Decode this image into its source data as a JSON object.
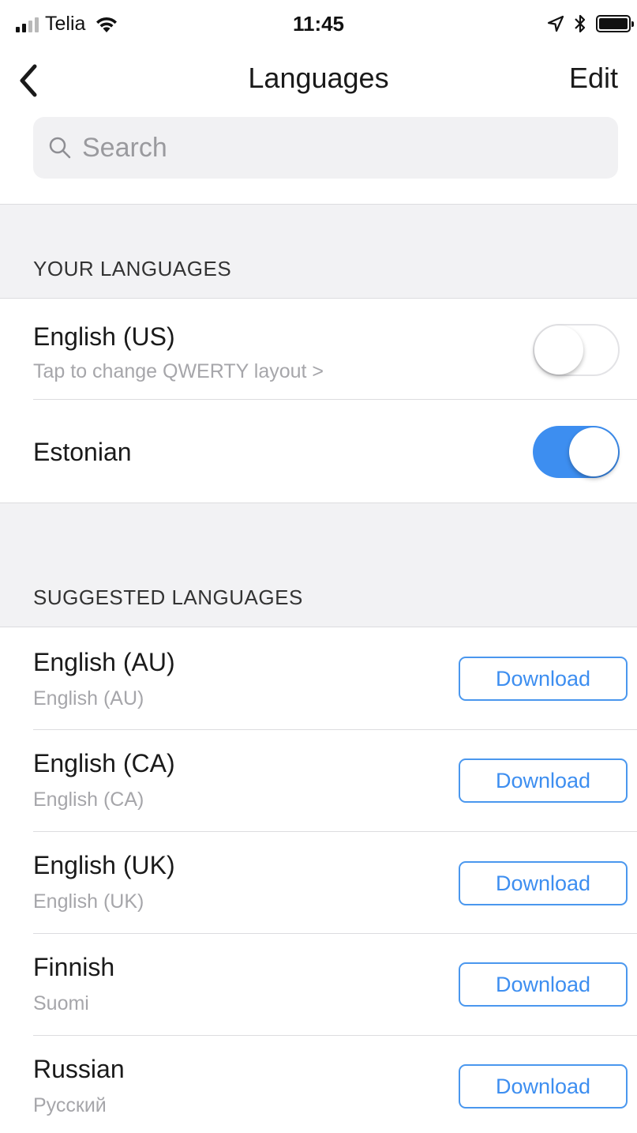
{
  "status_bar": {
    "carrier": "Telia",
    "time": "11:45",
    "signal_icon": "signal-bars-icon",
    "wifi_icon": "wifi-icon",
    "location_icon": "location-arrow-icon",
    "bluetooth_icon": "bluetooth-icon",
    "battery_icon": "battery-icon"
  },
  "nav": {
    "back_icon": "chevron-left-icon",
    "title": "Languages",
    "edit_label": "Edit"
  },
  "search": {
    "placeholder": "Search",
    "value": ""
  },
  "your_languages": {
    "header": "YOUR LANGUAGES",
    "items": [
      {
        "title": "English (US)",
        "subtitle": "Tap to change QWERTY layout >",
        "enabled": false
      },
      {
        "title": "Estonian",
        "subtitle": "",
        "enabled": true
      }
    ]
  },
  "suggested_languages": {
    "header": "SUGGESTED LANGUAGES",
    "button_label": "Download",
    "items": [
      {
        "title": "English (AU)",
        "subtitle": "English (AU)"
      },
      {
        "title": "English (CA)",
        "subtitle": "English (CA)"
      },
      {
        "title": "English (UK)",
        "subtitle": "English (UK)"
      },
      {
        "title": "Finnish",
        "subtitle": "Suomi"
      },
      {
        "title": "Russian",
        "subtitle": "Русский"
      }
    ]
  },
  "colors": {
    "accent": "#3d8ef0",
    "section_bg": "#f2f2f4",
    "secondary_text": "#a6a6aa"
  }
}
